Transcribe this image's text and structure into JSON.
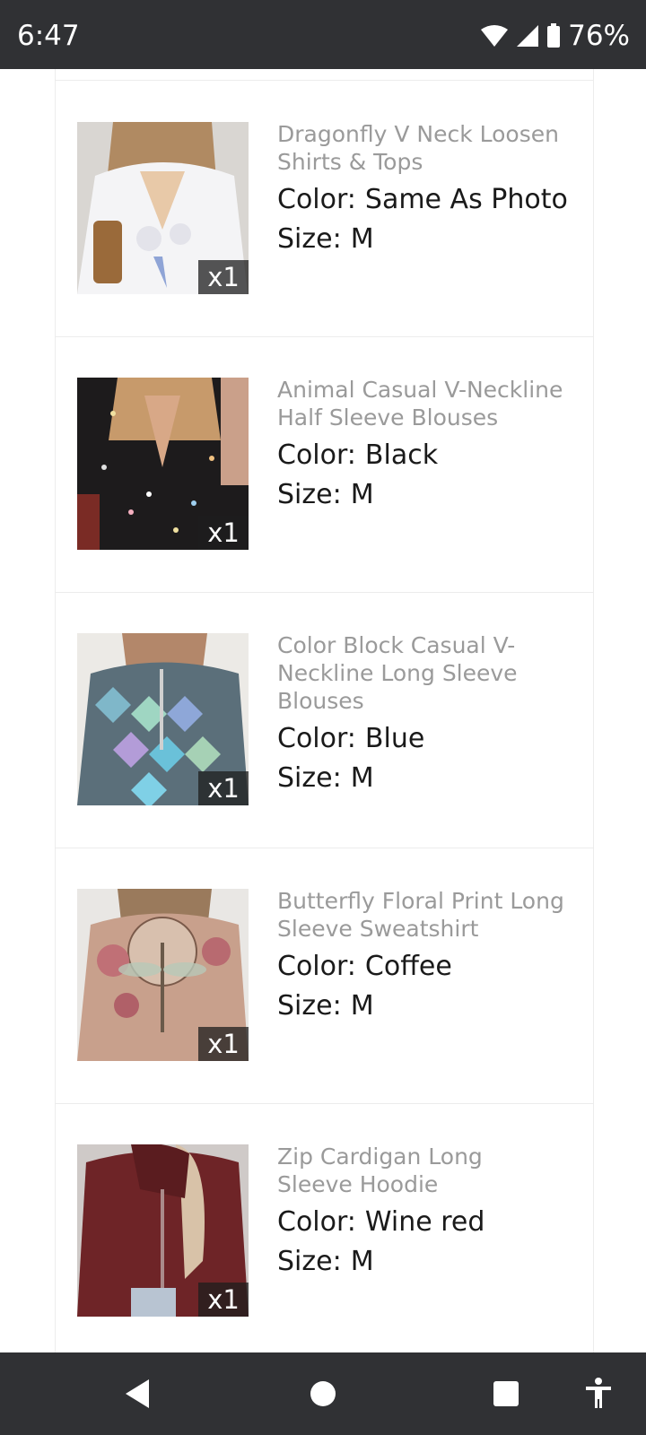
{
  "status_bar": {
    "time": "6:47",
    "battery": "76%",
    "icons": [
      "wifi-icon",
      "signal-icon",
      "battery-icon"
    ]
  },
  "items": [
    {
      "name": "Dragonfly V Neck Loosen Shirts & Tops",
      "color_label": "Color:",
      "color": "Same As Photo",
      "size_label": "Size:",
      "size": "M",
      "qty": "x1"
    },
    {
      "name": "Animal Casual V-Neckline Half Sleeve Blouses",
      "color_label": "Color:",
      "color": "Black",
      "size_label": "Size:",
      "size": "M",
      "qty": "x1"
    },
    {
      "name": "Color Block Casual V-Neckline Long Sleeve Blouses",
      "color_label": "Color:",
      "color": "Blue",
      "size_label": "Size:",
      "size": "M",
      "qty": "x1"
    },
    {
      "name": "Butterfly Floral Print Long Sleeve Sweatshirt",
      "color_label": "Color:",
      "color": "Coffee",
      "size_label": "Size:",
      "size": "M",
      "qty": "x1"
    },
    {
      "name": "Zip Cardigan Long Sleeve Hoodie",
      "color_label": "Color:",
      "color": "Wine red",
      "size_label": "Size:",
      "size": "M",
      "qty": "x1"
    }
  ],
  "nav_bar": {
    "icons": [
      "back-icon",
      "home-icon",
      "recents-icon",
      "accessibility-icon"
    ]
  },
  "colors": {
    "system_bar": "#303134",
    "product_name": "#9a9a9a",
    "attribute_text": "#1a1a1a",
    "divider": "#ececec"
  }
}
